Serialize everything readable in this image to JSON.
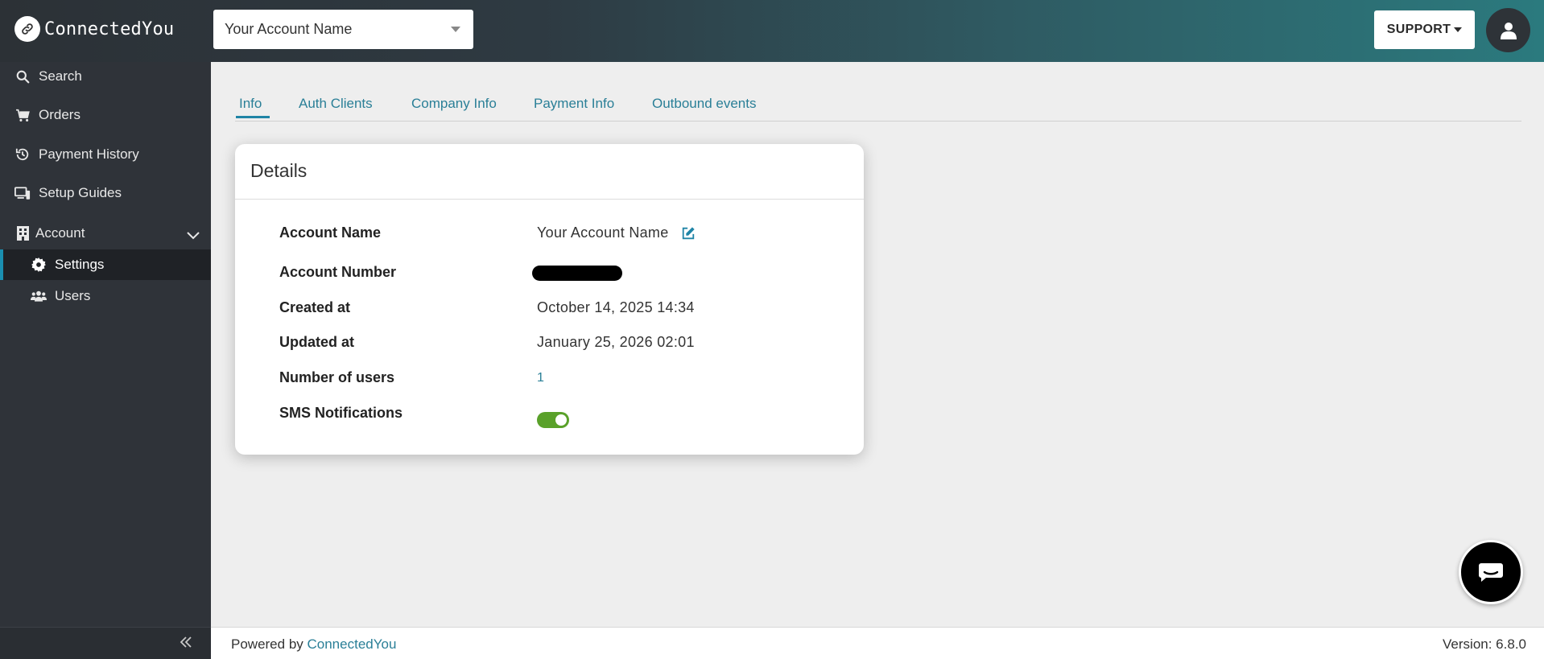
{
  "app": {
    "name": "ConnectedYou"
  },
  "header": {
    "account_selector": "Your Account Name",
    "support_label": "SUPPORT"
  },
  "sidebar": {
    "items": [
      {
        "label": "Search",
        "icon": "search-icon"
      },
      {
        "label": "Orders",
        "icon": "cart-icon"
      },
      {
        "label": "Payment History",
        "icon": "history-icon"
      },
      {
        "label": "Setup Guides",
        "icon": "devices-icon"
      },
      {
        "label": "Account",
        "icon": "building-icon",
        "expanded": true
      },
      {
        "label": "Settings",
        "icon": "gear-icon",
        "active": true
      },
      {
        "label": "Users",
        "icon": "users-icon"
      }
    ]
  },
  "tabs": [
    {
      "label": "Info",
      "active": true
    },
    {
      "label": "Auth Clients"
    },
    {
      "label": "Company Info"
    },
    {
      "label": "Payment Info"
    },
    {
      "label": "Outbound events"
    }
  ],
  "details": {
    "title": "Details",
    "rows": [
      {
        "label": "Account Name",
        "value": "Your Account Name"
      },
      {
        "label": "Account Number",
        "value": ""
      },
      {
        "label": "Created at",
        "value": "October 14, 2025 14:34"
      },
      {
        "label": "Updated at",
        "value": "January 25, 2026 02:01"
      },
      {
        "label": "Number of users",
        "value": "1"
      },
      {
        "label": "SMS Notifications",
        "value_on": true
      }
    ]
  },
  "footer": {
    "powered_by": "Powered by ",
    "link": "ConnectedYou",
    "version": "Version: 6.8.0"
  },
  "colors": {
    "accent": "#2a7f97",
    "sidebar_bg": "#2f3339",
    "toggle_on": "#5aa12a"
  }
}
